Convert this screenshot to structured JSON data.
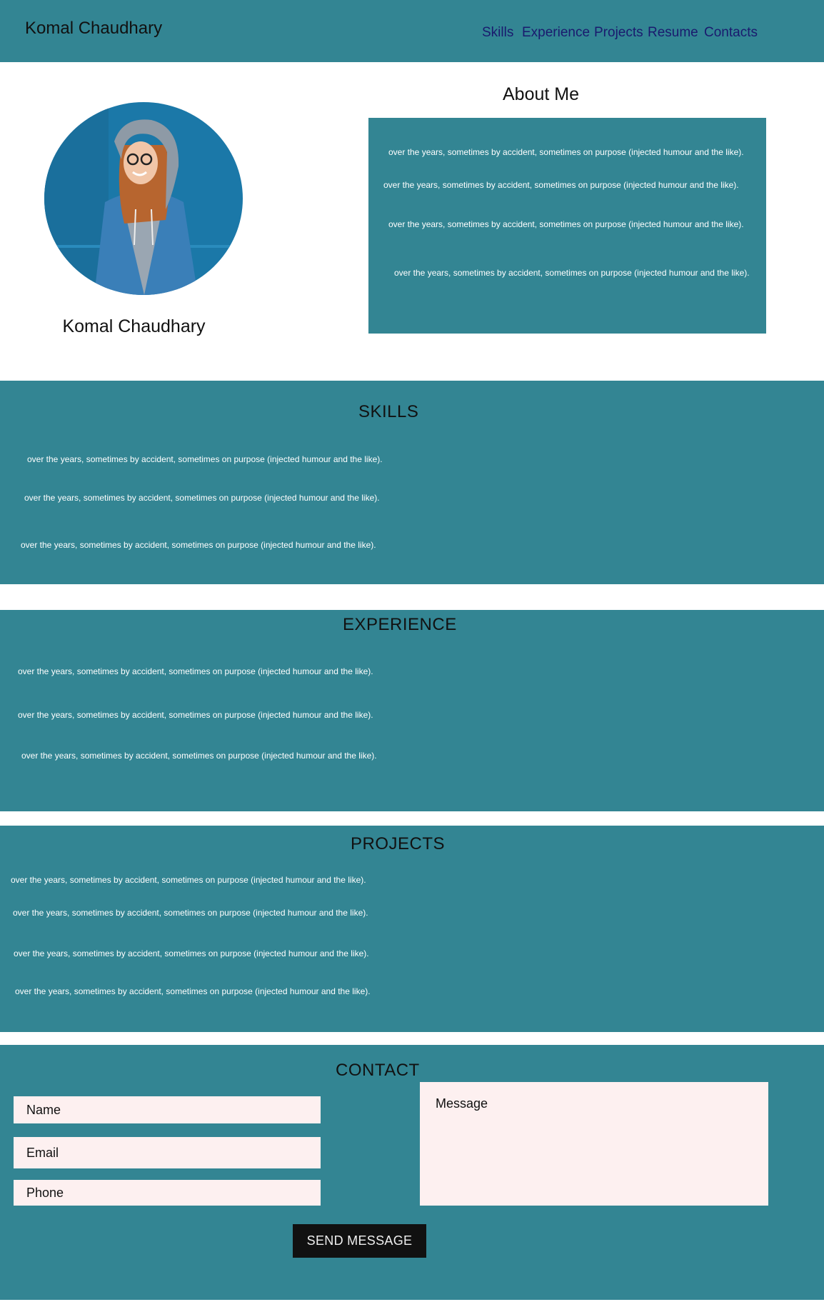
{
  "header": {
    "brand": "Komal Chaudhary",
    "nav": [
      {
        "label": "Skills"
      },
      {
        "label": "Experience"
      },
      {
        "label": "Projects"
      },
      {
        "label": "Resume"
      },
      {
        "label": "Contacts"
      }
    ]
  },
  "profile": {
    "name": "Komal Chaudhary",
    "photo_icon": "person-photo"
  },
  "about": {
    "title": "About Me",
    "lines": [
      "over the years, sometimes by accident, sometimes on purpose (injected humour and the like).",
      "over the years, sometimes by accident, sometimes on purpose (injected humour and the like).",
      "over the years, sometimes by accident, sometimes on purpose (injected humour and the like).",
      "over the years, sometimes by accident, sometimes on purpose (injected humour and the like)."
    ]
  },
  "skills": {
    "title": "SKILLS",
    "lines": [
      "over the years, sometimes by accident, sometimes on purpose (injected humour and the like).",
      "over the years, sometimes by accident, sometimes on purpose (injected humour and the like).",
      "over the years, sometimes by accident, sometimes on purpose (injected humour and the like)."
    ]
  },
  "experience": {
    "title": "EXPERIENCE",
    "lines": [
      "over the years, sometimes by accident, sometimes on purpose (injected humour and the like).",
      "over the years, sometimes by accident, sometimes on purpose (injected humour and the like).",
      "over the years, sometimes by accident, sometimes on purpose (injected humour and the like)."
    ]
  },
  "projects": {
    "title": "PROJECTS",
    "lines": [
      "over the years, sometimes by accident, sometimes on purpose (injected humour and the like).",
      "over the years, sometimes by accident, sometimes on purpose (injected humour and the like).",
      "over the years, sometimes by accident, sometimes on purpose (injected humour and the like).",
      "over the years, sometimes by accident, sometimes on purpose (injected humour and the like)."
    ]
  },
  "contact": {
    "title": "CONTACT",
    "name_placeholder": "Name",
    "email_placeholder": "Email",
    "phone_placeholder": "Phone",
    "message_placeholder": "Message",
    "send_label": "SEND MESSAGE"
  },
  "colors": {
    "teal": "#338593",
    "nav_link": "#1a1a6e",
    "field_bg": "#fdf0f0",
    "button_bg": "#111111"
  }
}
